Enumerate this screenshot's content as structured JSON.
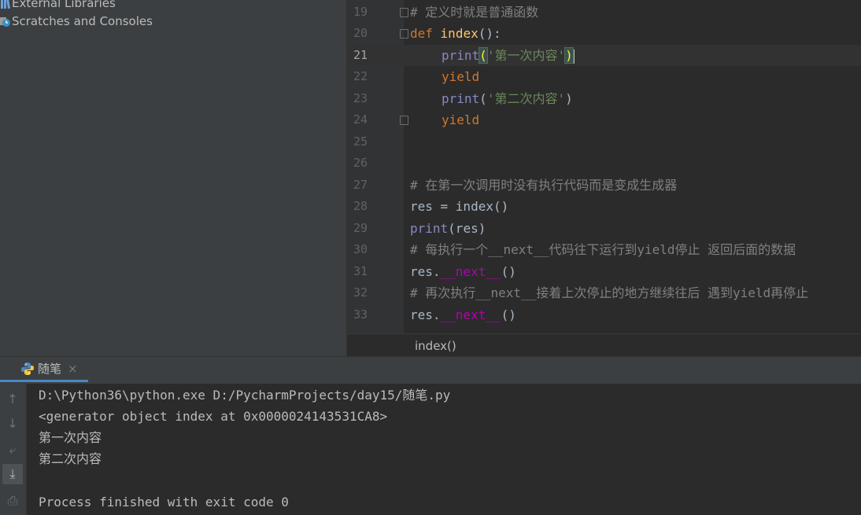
{
  "project": {
    "items": [
      {
        "label": "External Libraries",
        "icon": "library-icon"
      },
      {
        "label": "Scratches and Consoles",
        "icon": "scratches-icon"
      }
    ]
  },
  "editor": {
    "current_line": 21,
    "lines": [
      {
        "n": "19",
        "c": "# 定义时就是普通函数"
      },
      {
        "n": "20",
        "kw": "def",
        "fn": "index",
        "tail": "():"
      },
      {
        "n": "21",
        "bi": "print",
        "open": "(",
        "str": "'第一次内容'",
        "close": ")"
      },
      {
        "n": "22",
        "kw": "yield"
      },
      {
        "n": "23",
        "bi": "print",
        "open": "(",
        "str": "'第二次内容'",
        "close": ")"
      },
      {
        "n": "24",
        "kw": "yield"
      },
      {
        "n": "25"
      },
      {
        "n": "26"
      },
      {
        "n": "27",
        "c": "# 在第一次调用时没有执行代码而是变成生成器"
      },
      {
        "n": "28",
        "t": "res = index()"
      },
      {
        "n": "29",
        "bi": "print",
        "t": "(res)"
      },
      {
        "n": "30",
        "c": "# 每执行一个__next__代码往下运行到yield停止 返回后面的数据"
      },
      {
        "n": "31",
        "pre": "res.",
        "magic": "__next__",
        "tail": "()"
      },
      {
        "n": "32",
        "c": "# 再次执行__next__接着上次停止的地方继续往后 遇到yield再停止"
      },
      {
        "n": "33",
        "pre": "res.",
        "magic": "__next__",
        "tail": "()"
      }
    ],
    "breadcrumb": "index()"
  },
  "run": {
    "tab_label": "随笔",
    "tab_close": "×",
    "toolbar": [
      {
        "icon": "arrow-up-icon",
        "glyph": "↑"
      },
      {
        "icon": "arrow-down-icon",
        "glyph": "↓"
      },
      {
        "icon": "soft-wrap-icon",
        "glyph": "⤶"
      },
      {
        "icon": "scroll-to-end-icon",
        "glyph": "⤓"
      },
      {
        "icon": "print-icon",
        "glyph": "⎙"
      }
    ],
    "output": [
      "D:\\Python36\\python.exe D:/PycharmProjects/day15/随笔.py",
      "<generator object index at 0x0000024143531CA8>",
      "第一次内容",
      "第二次内容",
      "",
      "Process finished with exit code 0"
    ]
  },
  "colors": {
    "keyword": "#cc7832",
    "function": "#ffc66d",
    "builtin": "#8888c6",
    "string": "#6a8759",
    "comment": "#808080",
    "magic": "#b200b2",
    "accent": "#4a88c7"
  }
}
